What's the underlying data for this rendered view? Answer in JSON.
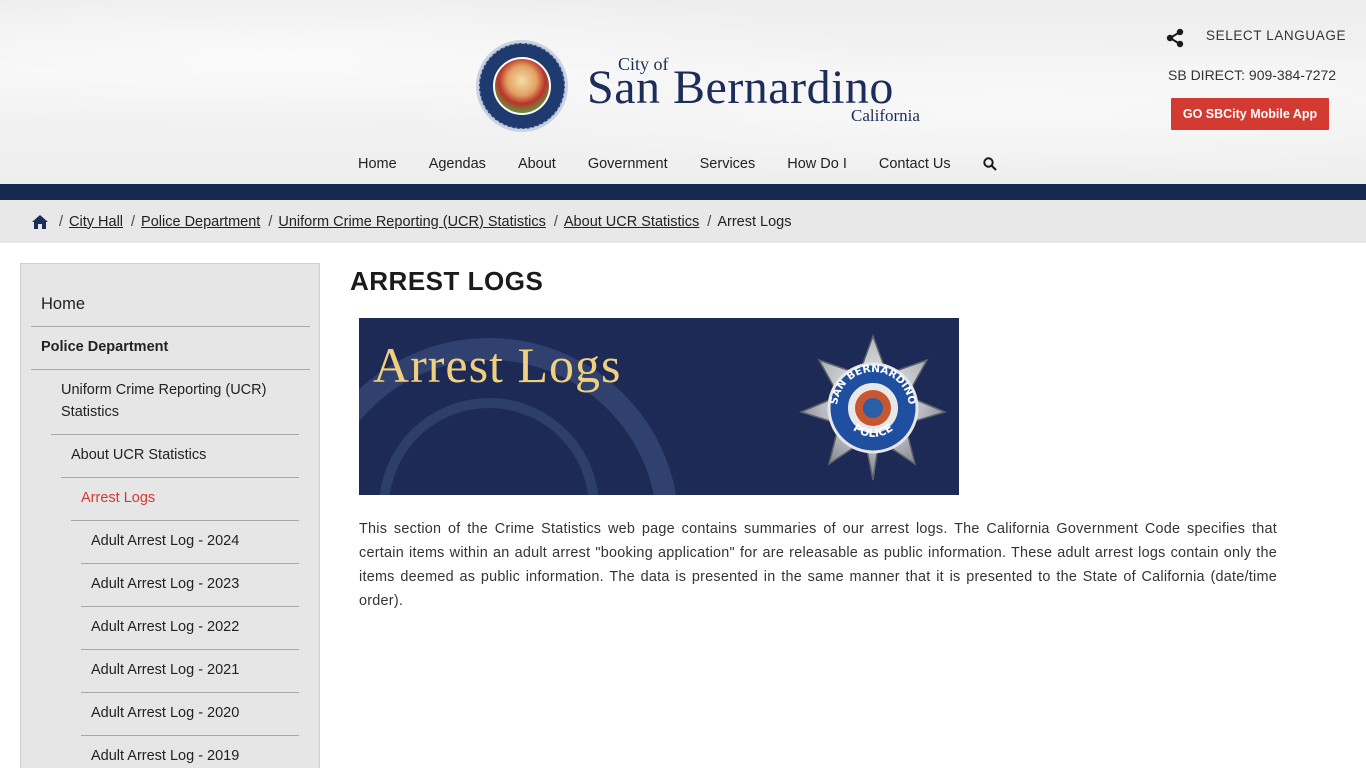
{
  "header": {
    "logo": {
      "city_of": "City of",
      "name": "San Bernardino",
      "state": "California",
      "seal_text": "CITY OF SAN BERNARDINO CALIFORNIA · FOUNDED IN 1810"
    },
    "select_language": "SELECT LANGUAGE",
    "sb_direct": "SB DIRECT: 909-384-7272",
    "app_button": "GO SBCity Mobile App",
    "nav": [
      "Home",
      "Agendas",
      "About",
      "Government",
      "Services",
      "How Do I",
      "Contact Us"
    ]
  },
  "breadcrumb": {
    "items": [
      "City Hall",
      "Police Department",
      "Uniform Crime Reporting (UCR) Statistics",
      "About UCR Statistics"
    ],
    "current": "Arrest Logs"
  },
  "sidebar": {
    "home": "Home",
    "police": "Police Department",
    "ucr_line1": "Uniform Crime Reporting (UCR)",
    "ucr_line2": "Statistics",
    "about_ucr": "About UCR Statistics",
    "arrest_logs": "Arrest Logs",
    "logs": [
      "Adult Arrest Log - 2024",
      "Adult Arrest Log - 2023",
      "Adult Arrest Log - 2022",
      "Adult Arrest Log - 2021",
      "Adult Arrest Log - 2020",
      "Adult Arrest Log - 2019"
    ]
  },
  "main": {
    "title": "ARREST LOGS",
    "banner_title": "Arrest Logs",
    "badge_top": "SAN BERNARDINO",
    "badge_bottom": "POLICE",
    "body": "This section of the Crime Statistics web page contains summaries of our arrest logs. The California Government Code specifies that certain items within an adult arrest \"booking application\" for are releasable as public information. These adult arrest logs contain only the items deemed as public information. The data is presented in the same manner that it is presented to the State of California (date/time order)."
  },
  "colors": {
    "navy": "#14294d",
    "red_button": "#d33a32",
    "active_link": "#d33a32",
    "banner_gold": "#f0cf7d"
  }
}
